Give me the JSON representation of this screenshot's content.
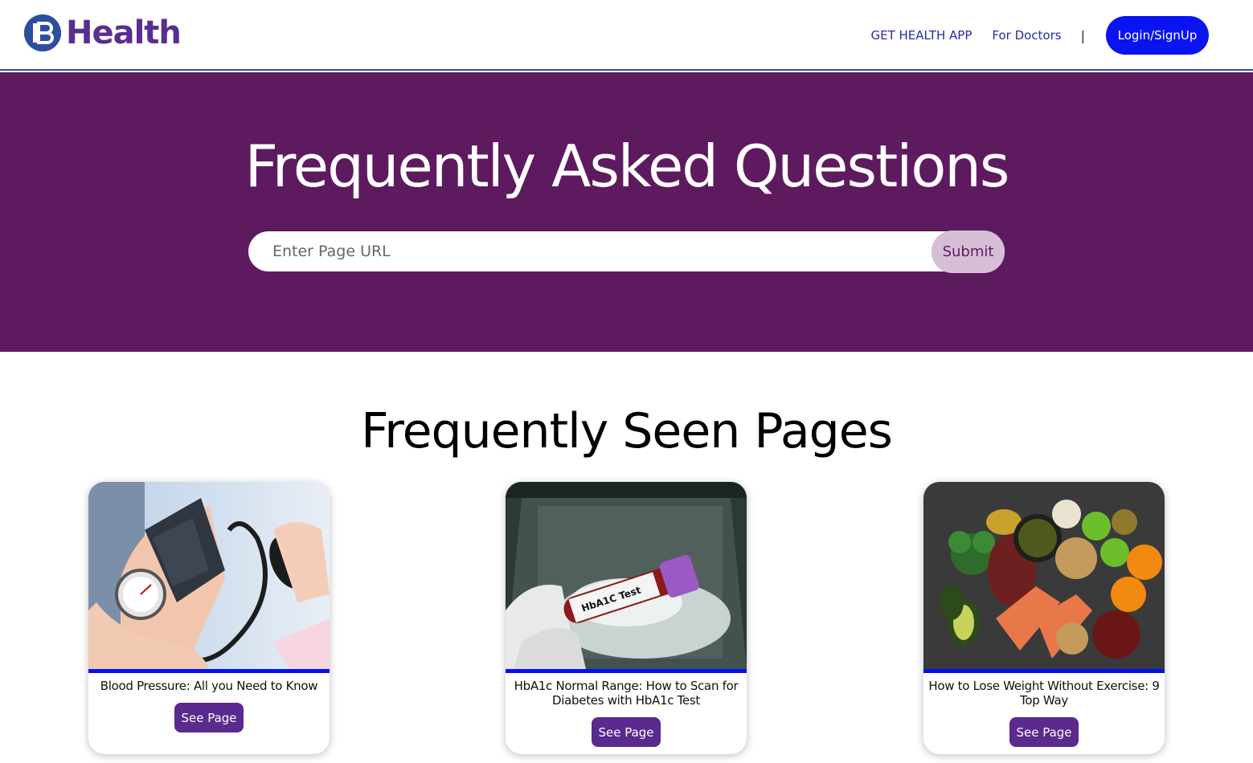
{
  "header": {
    "logo_text": "Health",
    "nav": {
      "app_link": "GET HEALTH APP",
      "doctors_link": "For Doctors",
      "separator": "|",
      "login_button": "Login/SignUp"
    }
  },
  "hero": {
    "title": "Frequently Asked Questions",
    "search": {
      "placeholder": "Enter Page URL",
      "value": "",
      "submit_label": "Submit"
    }
  },
  "section": {
    "title": "Frequently Seen Pages"
  },
  "cards": [
    {
      "title": "Blood Pressure: All you Need to Know",
      "button": "See Page",
      "image": "blood-pressure-measurement"
    },
    {
      "title": "HbA1c Normal Range: How to Scan for Diabetes with HbA1c Test",
      "button": "See Page",
      "image": "hba1c-test-tube",
      "tube_label": "HbA1C Test"
    },
    {
      "title": "How to Lose Weight Without Exercise: 9 Top Way",
      "button": "See Page",
      "image": "healthy-food-spread"
    }
  ],
  "colors": {
    "brand_purple": "#5e1a5e",
    "logo_blue": "#2a4f9c",
    "logo_text": "#5a2d91",
    "login_blue": "#0a14f0",
    "card_accent": "#0010f5",
    "button_purple": "#5a2a8e",
    "submit_bg": "#d6bfd6"
  }
}
